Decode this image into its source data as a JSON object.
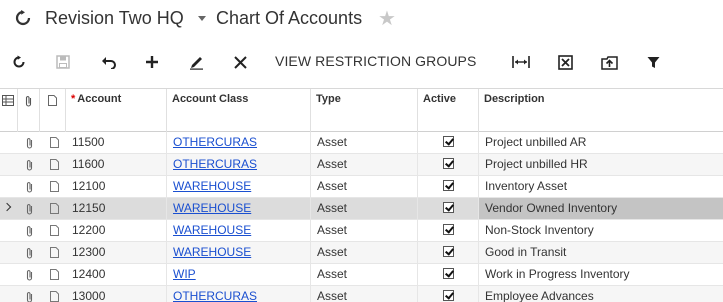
{
  "header": {
    "company": "Revision Two HQ",
    "screen_title": "Chart Of Accounts"
  },
  "toolbar": {
    "view_restriction_groups": "VIEW RESTRICTION GROUPS",
    "icons": [
      "refresh-icon",
      "save-icon",
      "undo-icon",
      "add-icon",
      "edit-icon",
      "delete-icon",
      "fit-columns-icon",
      "export-excel-icon",
      "upload-icon",
      "filter-icon"
    ]
  },
  "grid": {
    "columns": {
      "account": "Account",
      "account_class": "Account Class",
      "type": "Type",
      "active": "Active",
      "description": "Description"
    },
    "rows": [
      {
        "account": "11500",
        "account_class": "OTHERCURAS",
        "type": "Asset",
        "active": true,
        "description": "Project unbilled AR"
      },
      {
        "account": "11600",
        "account_class": "OTHERCURAS",
        "type": "Asset",
        "active": true,
        "description": "Project unbilled HR"
      },
      {
        "account": "12100",
        "account_class": "WAREHOUSE",
        "type": "Asset",
        "active": true,
        "description": "Inventory Asset"
      },
      {
        "account": "12150",
        "account_class": "WAREHOUSE",
        "type": "Asset",
        "active": true,
        "description": "Vendor Owned Inventory",
        "selected": true
      },
      {
        "account": "12200",
        "account_class": "WAREHOUSE",
        "type": "Asset",
        "active": true,
        "description": "Non-Stock Inventory"
      },
      {
        "account": "12300",
        "account_class": "WAREHOUSE",
        "type": "Asset",
        "active": true,
        "description": "Good in Transit"
      },
      {
        "account": "12400",
        "account_class": "WIP",
        "type": "Asset",
        "active": true,
        "description": "Work in Progress Inventory"
      },
      {
        "account": "13000",
        "account_class": "OTHERCURAS",
        "type": "Asset",
        "active": true,
        "description": "Employee Advances"
      }
    ]
  }
}
